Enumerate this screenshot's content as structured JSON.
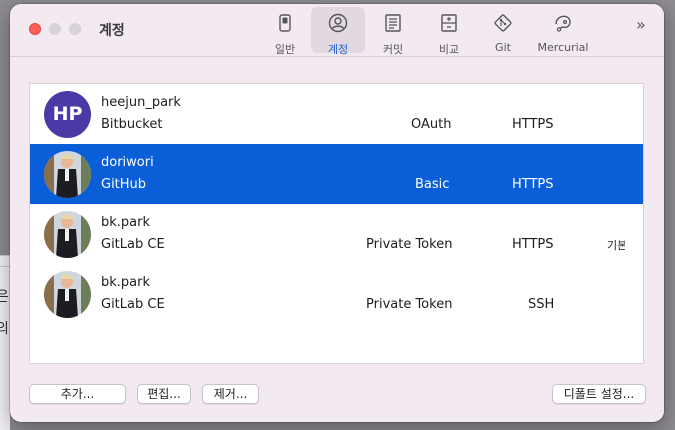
{
  "window": {
    "title": "계정"
  },
  "toolbar": {
    "items": [
      {
        "label": "일반",
        "icon": "switch-icon"
      },
      {
        "label": "계정",
        "icon": "person-circle-icon"
      },
      {
        "label": "커밋",
        "icon": "document-lines-icon"
      },
      {
        "label": "비교",
        "icon": "compare-icon"
      },
      {
        "label": "Git",
        "icon": "git-icon"
      },
      {
        "label": "Mercurial",
        "icon": "mercurial-icon"
      }
    ],
    "active": "계정",
    "overflow": "»"
  },
  "accounts": [
    {
      "avatar_text": "HP",
      "username": "heejun_park",
      "host": "Bitbucket",
      "auth": "OAuth",
      "protocol": "HTTPS",
      "extra": ""
    },
    {
      "avatar_text": "",
      "username": "doriwori",
      "host": "GitHub",
      "auth": "Basic",
      "protocol": "HTTPS",
      "extra": ""
    },
    {
      "avatar_text": "",
      "username": "bk.park",
      "host": "GitLab CE",
      "auth": "Private Token",
      "protocol": "HTTPS",
      "extra": "기본"
    },
    {
      "avatar_text": "",
      "username": "bk.park",
      "host": "GitLab CE",
      "auth": "Private Token",
      "protocol": "SSH",
      "extra": ""
    }
  ],
  "buttons": {
    "add": "추가...",
    "edit": "편집...",
    "remove": "제거...",
    "set_default": "디폴트 설정..."
  },
  "background_peek": [
    "은",
    "의"
  ],
  "colors": {
    "selection": "#0a5fd8",
    "accent": "#1d63d6",
    "avatar_hp": "#4b3aa5"
  }
}
